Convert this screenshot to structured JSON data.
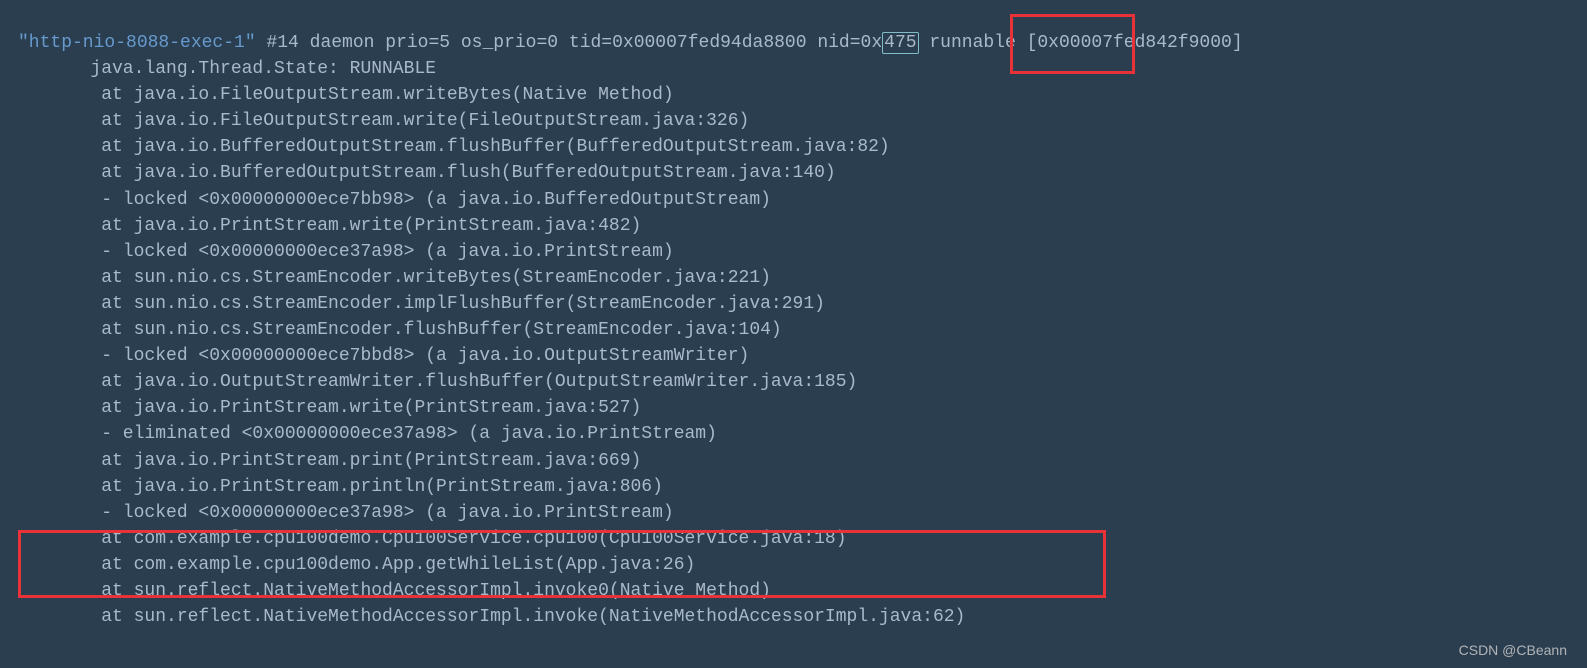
{
  "header": {
    "prefix": "\"http-nio-8088-exec-1\"",
    "mid": " #14 daemon prio=5 os_prio=0 tid=0x00007fed94da8800 nid=0x",
    "nid_highlight": "475",
    "suffix": " runnable [0x00007fed842f9000]"
  },
  "lines": [
    "   java.lang.Thread.State: RUNNABLE",
    "    at java.io.FileOutputStream.writeBytes(Native Method)",
    "    at java.io.FileOutputStream.write(FileOutputStream.java:326)",
    "    at java.io.BufferedOutputStream.flushBuffer(BufferedOutputStream.java:82)",
    "    at java.io.BufferedOutputStream.flush(BufferedOutputStream.java:140)",
    "    - locked <0x00000000ece7bb98> (a java.io.BufferedOutputStream)",
    "    at java.io.PrintStream.write(PrintStream.java:482)",
    "    - locked <0x00000000ece37a98> (a java.io.PrintStream)",
    "    at sun.nio.cs.StreamEncoder.writeBytes(StreamEncoder.java:221)",
    "    at sun.nio.cs.StreamEncoder.implFlushBuffer(StreamEncoder.java:291)",
    "    at sun.nio.cs.StreamEncoder.flushBuffer(StreamEncoder.java:104)",
    "    - locked <0x00000000ece7bbd8> (a java.io.OutputStreamWriter)",
    "    at java.io.OutputStreamWriter.flushBuffer(OutputStreamWriter.java:185)",
    "    at java.io.PrintStream.write(PrintStream.java:527)",
    "    - eliminated <0x00000000ece37a98> (a java.io.PrintStream)",
    "    at java.io.PrintStream.print(PrintStream.java:669)",
    "    at java.io.PrintStream.println(PrintStream.java:806)",
    "    - locked <0x00000000ece37a98> (a java.io.PrintStream)",
    "    at com.example.cpu100demo.Cpu100Service.cpu100(Cpu100Service.java:18)",
    "    at com.example.cpu100demo.App.getWhileList(App.java:26)",
    "    at sun.reflect.NativeMethodAccessorImpl.invoke0(Native Method)",
    "    at sun.reflect.NativeMethodAccessorImpl.invoke(NativeMethodAccessorImpl.java:62)"
  ],
  "watermark": "CSDN @CBeann"
}
